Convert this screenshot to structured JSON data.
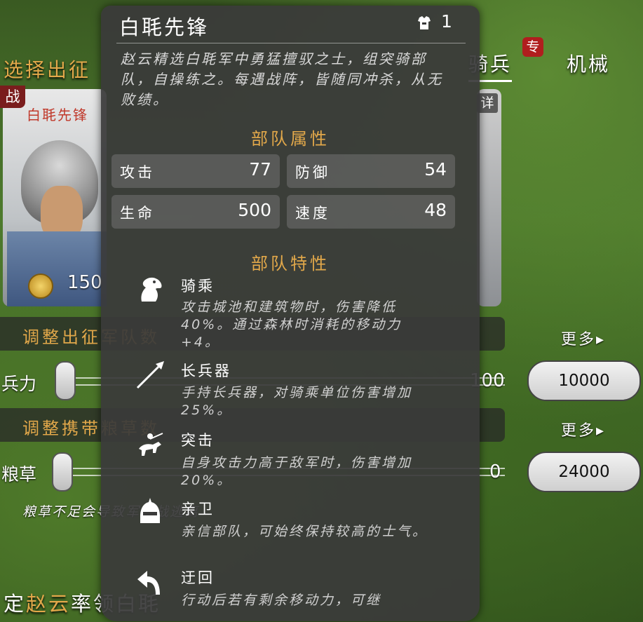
{
  "background": {
    "section_title": "选择出征",
    "tabs": [
      {
        "label": "骑兵",
        "active": true,
        "badge": "专"
      },
      {
        "label": "机械",
        "active": false
      }
    ],
    "unit_card": {
      "badge": "战",
      "name": "白毦先锋",
      "cost": "150"
    },
    "detail_badge": "详",
    "adjust_troops": {
      "label": "调整出征军队数",
      "more": "更多▸",
      "slider_label": "兵力",
      "slider_value": "100",
      "max_value": "10000"
    },
    "adjust_food": {
      "label": "调整携带粮草数",
      "more": "更多▸",
      "slider_label": "粮草",
      "slider_value": "0",
      "max_value": "24000"
    },
    "warning": "粮草不足会导致军队战逃离",
    "bottom_line": {
      "prefix": "定",
      "hero": "赵云",
      "rest": "率领白毦"
    }
  },
  "tooltip": {
    "title": "白毦先锋",
    "count": "1",
    "description": "赵云精选白毦军中勇猛擅驭之士，组突骑部队，自操练之。每遇战阵，皆随同冲杀，从无败绩。",
    "attributes_heading": "部队属性",
    "stats": [
      {
        "label": "攻击",
        "value": "77"
      },
      {
        "label": "防御",
        "value": "54"
      },
      {
        "label": "生命",
        "value": "500"
      },
      {
        "label": "速度",
        "value": "48"
      }
    ],
    "traits_heading": "部队特性",
    "traits": [
      {
        "icon": "horse-head-icon",
        "name": "骑乘",
        "desc": "攻击城池和建筑物时，伤害降低40%。通过森林时消耗的移动力+4。"
      },
      {
        "icon": "spear-icon",
        "name": "长兵器",
        "desc": "手持长兵器，对骑乘单位伤害增加25%。"
      },
      {
        "icon": "charging-rider-icon",
        "name": "突击",
        "desc": "自身攻击力高于敌军时，伤害增加20%。"
      },
      {
        "icon": "guard-helmet-icon",
        "name": "亲卫",
        "desc": "亲信部队，可始终保持较高的士气。"
      },
      {
        "icon": "turn-back-arrow-icon",
        "name": "迂回",
        "desc": "行动后若有剩余移动力，可继"
      }
    ]
  },
  "colors": {
    "gold": "#e2a84a",
    "tooltip_bg": "#3a3a3a",
    "badge_red": "#b01e1e"
  }
}
